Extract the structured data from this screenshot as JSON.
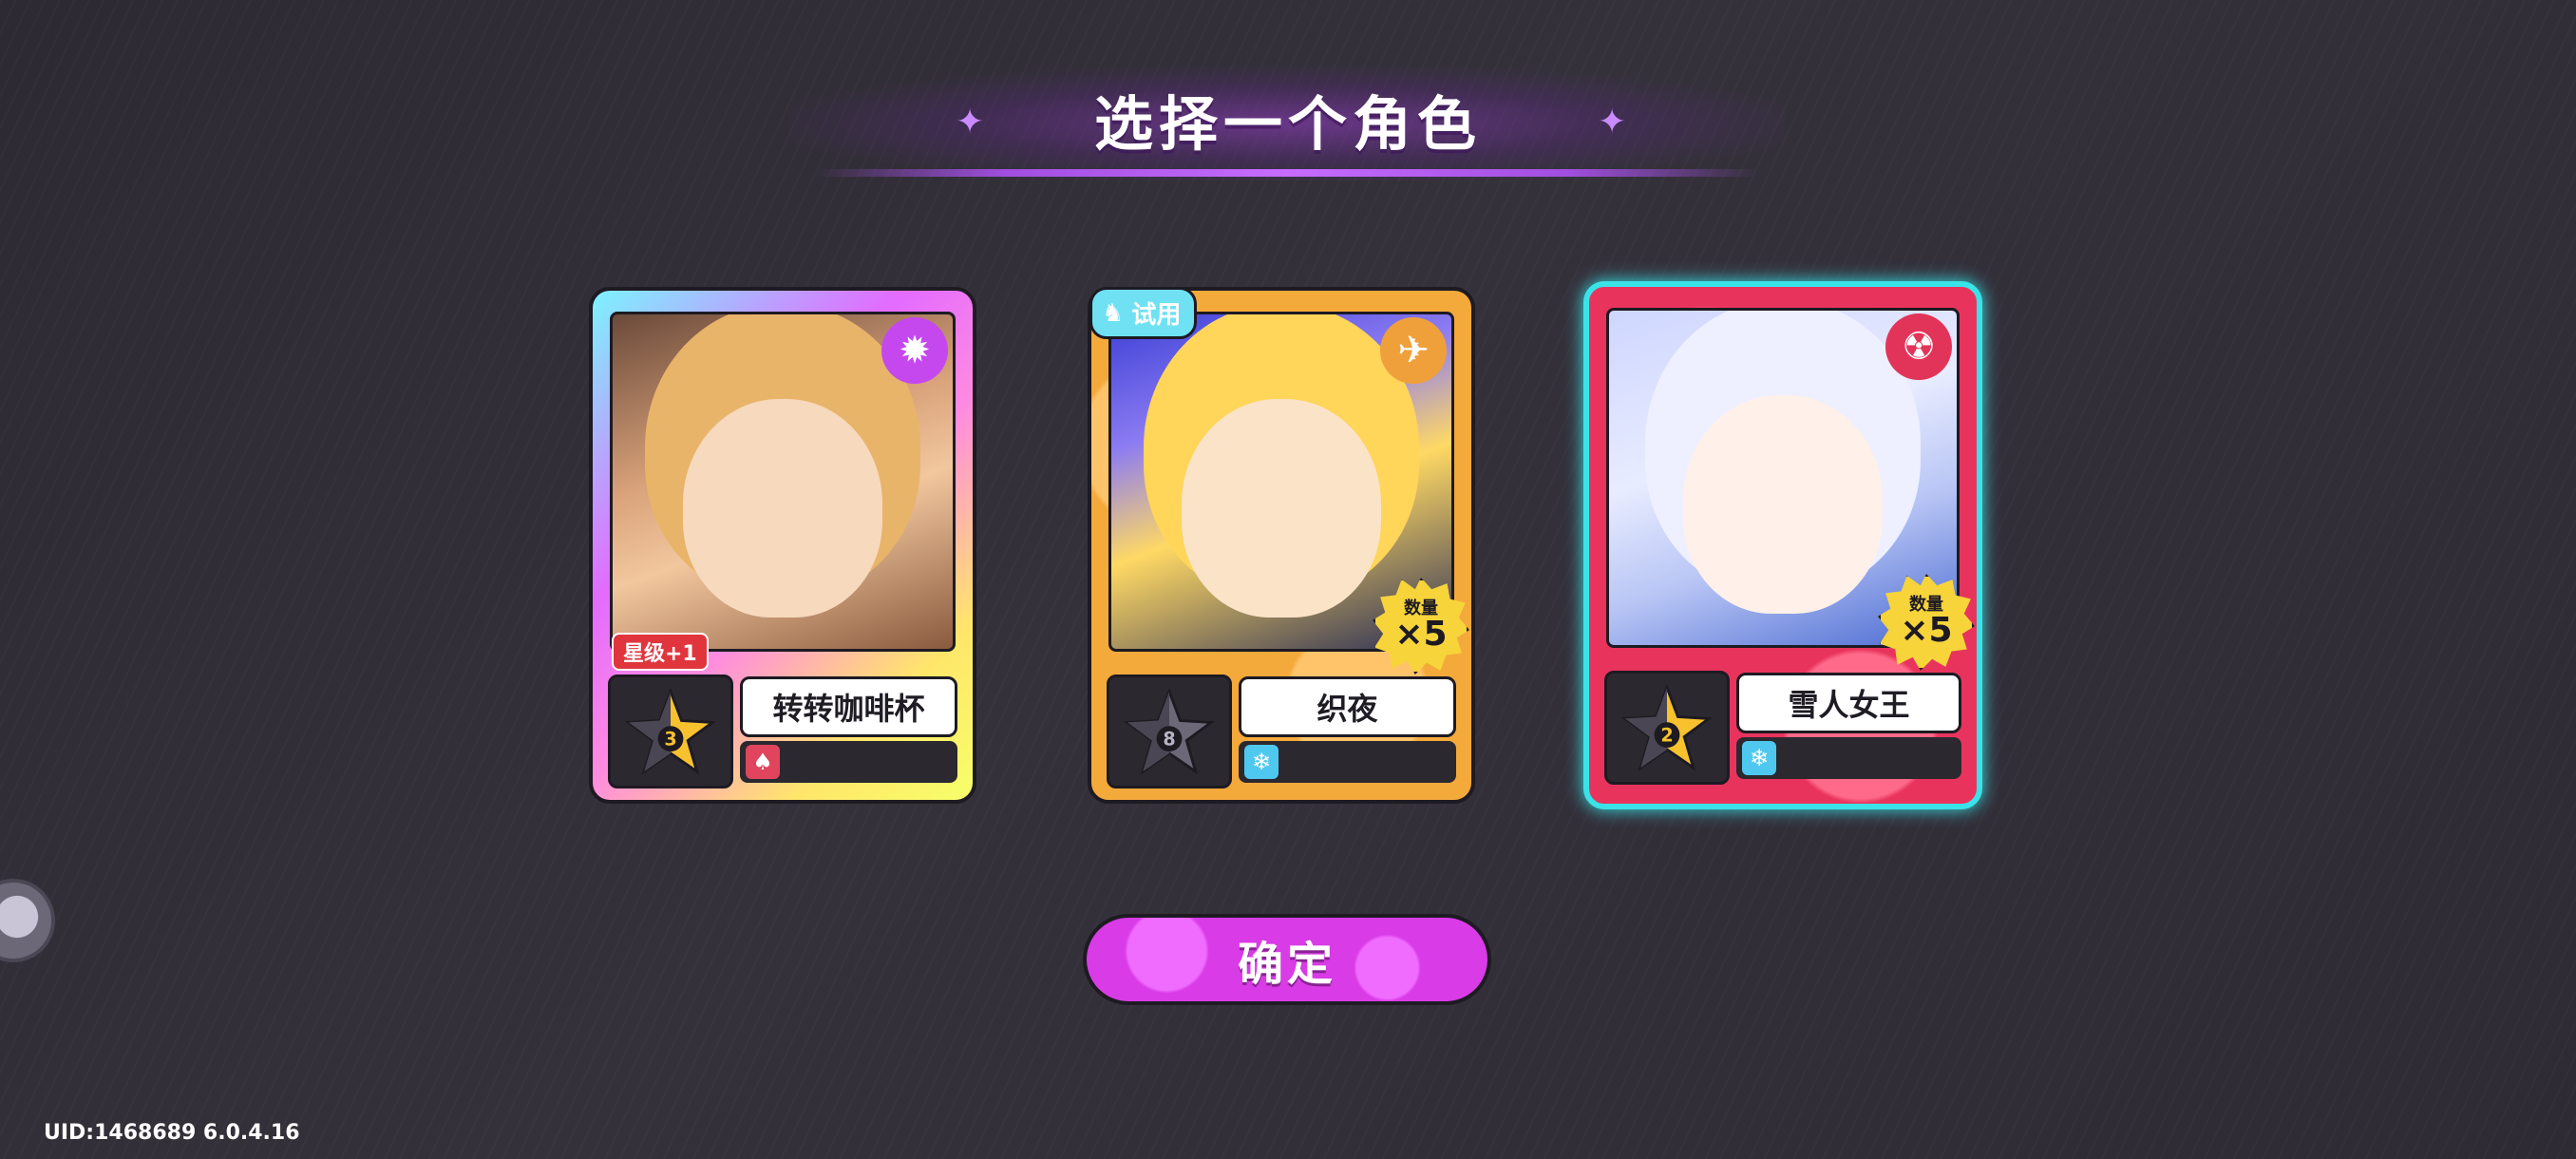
{
  "title": "选择一个角色",
  "cards": [
    {
      "name": "转转咖啡杯",
      "star_level": "3",
      "element_icon": "bomb-icon",
      "sub_icon": "mushroom-icon",
      "badge": "星级+1",
      "accent": "#c548ef"
    },
    {
      "name": "织夜",
      "star_level": "8",
      "element_icon": "satellite-icon",
      "sub_icon": "snowflake-icon",
      "trial_label": "试用",
      "quantity_label": "数量",
      "quantity_value": "×5",
      "accent": "#f4a93b"
    },
    {
      "name": "雪人女王",
      "star_level": "2",
      "element_icon": "radiation-icon",
      "sub_icon": "snowflake-icon",
      "quantity_label": "数量",
      "quantity_value": "×5",
      "selected": true,
      "accent": "#e8345d"
    }
  ],
  "confirm_label": "确定",
  "uid_text": "UID:1468689 6.0.4.16"
}
